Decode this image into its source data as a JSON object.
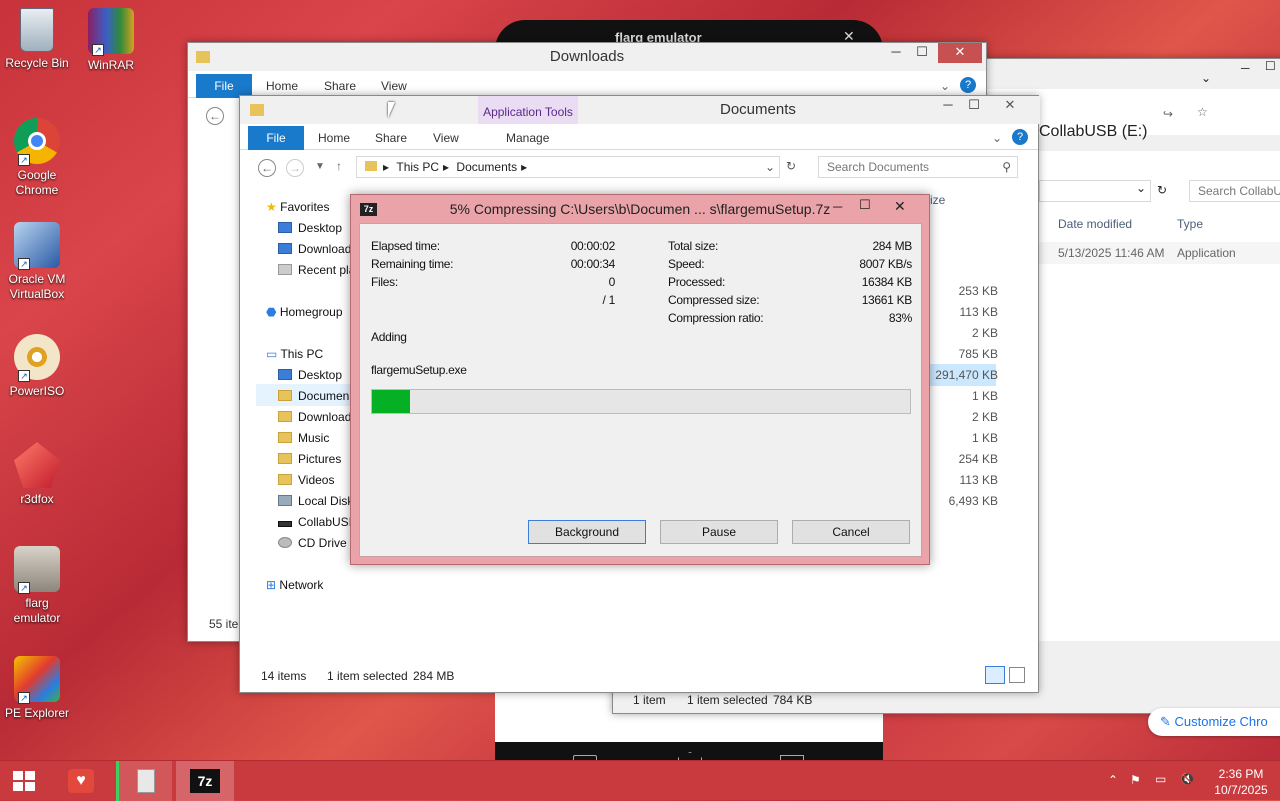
{
  "desktop": {
    "icons": [
      {
        "label": "Recycle Bin",
        "icon": "recycle-bin-icon"
      },
      {
        "label": "WinRAR",
        "icon": "winrar-icon"
      },
      {
        "label": "Google Chrome",
        "icon": "chrome-icon"
      },
      {
        "label": "Oracle VM VirtualBox",
        "icon": "virtualbox-icon"
      },
      {
        "label": "PowerISO",
        "icon": "poweriso-icon"
      },
      {
        "label": "r3dfox",
        "icon": "r3dfox-icon"
      },
      {
        "label": "flarg emulator",
        "icon": "flarg-emulator-icon"
      },
      {
        "label": "PE Explorer",
        "icon": "pe-explorer-icon"
      }
    ]
  },
  "emulator_window": {
    "title": "flarg emulator"
  },
  "downloads_window": {
    "title": "Downloads",
    "tabs": [
      "File",
      "Home",
      "Share",
      "View"
    ],
    "status": "55 ite"
  },
  "collabusb_window": {
    "title": "CollabUSB (E:)",
    "search_placeholder": "Search CollabUS",
    "columns": [
      "Date modified",
      "Type"
    ],
    "row": {
      "date": "5/13/2025 11:46 AM",
      "type": "Application"
    },
    "status_items": "1 item",
    "status_selected": "1 item selected",
    "status_size": "784 KB",
    "customize": "Customize Chro"
  },
  "documents_window": {
    "title": "Documents",
    "app_tools": "Application Tools",
    "tabs": [
      "File",
      "Home",
      "Share",
      "View",
      "Manage"
    ],
    "breadcrumb": [
      "This PC",
      "Documents"
    ],
    "search_placeholder": "Search Documents",
    "size_header": "ize",
    "nav": {
      "favorites": "Favorites",
      "desktop": "Desktop",
      "downloads": "Download",
      "recent": "Recent pla",
      "homegroup": "Homegroup",
      "this_pc": "This PC",
      "pc_desktop": "Desktop",
      "pc_documents": "Documen",
      "pc_downloads": "Download",
      "music": "Music",
      "pictures": "Pictures",
      "videos": "Videos",
      "local_disk": "Local Disk",
      "collabusb": "CollabUSB",
      "cd_drive": "CD Drive (",
      "network": "Network"
    },
    "sizes": [
      "253 KB",
      "113 KB",
      "2 KB",
      "785 KB",
      "291,470 KB",
      "1 KB",
      "2 KB",
      "1 KB",
      "254 KB",
      "113 KB",
      "6,493 KB"
    ],
    "status_items": "14 items",
    "status_selected": "1 item selected",
    "status_size": "284 MB"
  },
  "dialog": {
    "title": "5% Compressing C:\\Users\\b\\Documen ... s\\flargemuSetup.7z",
    "left": [
      {
        "label": "Elapsed time:",
        "value": "00:00:02"
      },
      {
        "label": "Remaining time:",
        "value": "00:00:34"
      },
      {
        "label": "Files:",
        "value": "0"
      },
      {
        "label": "",
        "value": "/ 1"
      }
    ],
    "right": [
      {
        "label": "Total size:",
        "value": "284 MB"
      },
      {
        "label": "Speed:",
        "value": "8007 KB/s"
      },
      {
        "label": "Processed:",
        "value": "16384 KB"
      },
      {
        "label": "Compressed size:",
        "value": "13661 KB"
      },
      {
        "label": "Compression ratio:",
        "value": "83%"
      }
    ],
    "action": "Adding",
    "file": "flargemuSetup.exe",
    "progress": 0.07,
    "buttons": {
      "background": "Background",
      "pause": "Pause",
      "cancel": "Cancel"
    }
  },
  "taskbar": {
    "time": "2:36 PM",
    "date": "10/7/2025"
  }
}
